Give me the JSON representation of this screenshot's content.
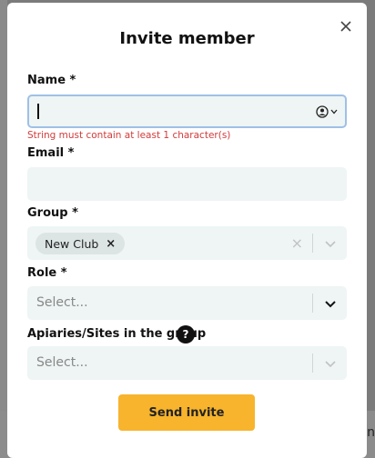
{
  "modal": {
    "title": "Invite member",
    "close_icon": "close-icon"
  },
  "fields": {
    "name": {
      "label": "Name *",
      "value": "",
      "error": "String must contain at least 1 character(s)"
    },
    "email": {
      "label": "Email *",
      "value": ""
    },
    "group": {
      "label": "Group *",
      "selected_chip": "New Club",
      "chip_remove": "×",
      "clear": "×"
    },
    "role": {
      "label": "Role *",
      "placeholder": "Select..."
    },
    "apiaries": {
      "label": "Apiaries/Sites in the group",
      "help": "?",
      "placeholder": "Select..."
    }
  },
  "actions": {
    "submit_label": "Send invite"
  },
  "background": {
    "partial_text": "n"
  },
  "colors": {
    "accent": "#f7b42c",
    "error": "#d23b3b",
    "field_bg": "#eef5f4",
    "focus_border": "#9ec0e6"
  }
}
